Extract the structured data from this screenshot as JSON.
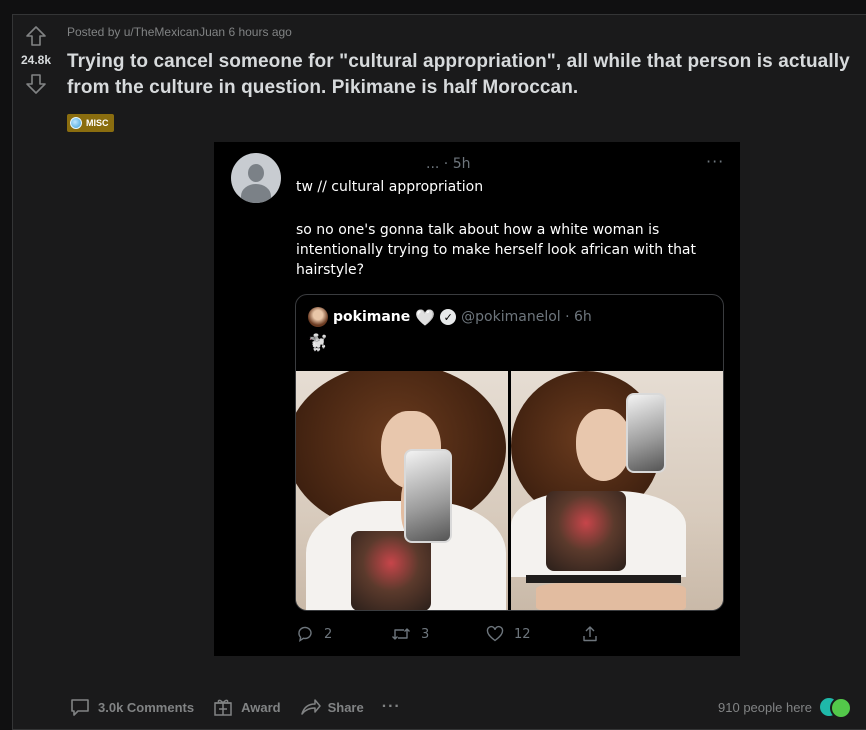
{
  "post": {
    "vote_count": "24.8k",
    "meta_prefix": "Posted by",
    "author": "u/TheMexicanJuan",
    "time": "6 hours ago",
    "title": "Trying to cancel someone for \"cultural appropriation\", all while that person is actually from the culture in question. Pikimane is half Moroccan.",
    "flair": "MISC"
  },
  "tweet": {
    "time": "... · 5h",
    "dots": "···",
    "handle_line": "tw // cultural appropriation",
    "text": "so no one's gonna talk about how a white woman is intentionally trying to make herself look african with that hairstyle?",
    "quote": {
      "name": "pokimane",
      "heart": "🤍",
      "verified": "✓",
      "handle": "@pokimanelol · 6h",
      "emoji": "🐩"
    },
    "actions": {
      "replies": "2",
      "retweets": "3",
      "likes": "12"
    }
  },
  "footer": {
    "comments": "3.0k Comments",
    "award": "Award",
    "share": "Share",
    "more": "···",
    "people_here": "910 people here"
  }
}
